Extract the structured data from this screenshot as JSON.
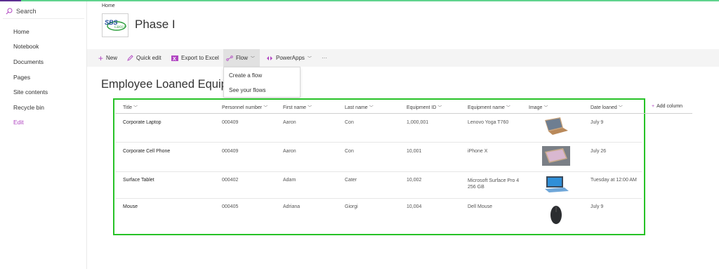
{
  "sidebar": {
    "search_label": "Search",
    "items": [
      {
        "label": "Home"
      },
      {
        "label": "Notebook"
      },
      {
        "label": "Documents"
      },
      {
        "label": "Pages"
      },
      {
        "label": "Site contents"
      },
      {
        "label": "Recycle bin"
      },
      {
        "label": "Edit"
      }
    ]
  },
  "header": {
    "breadcrumb": "Home",
    "site_title": "Phase I",
    "logo_text": "SBS GROUP"
  },
  "command_bar": {
    "new_label": "New",
    "quick_edit_label": "Quick edit",
    "export_label": "Export to Excel",
    "flow_label": "Flow",
    "powerapps_label": "PowerApps",
    "more_label": "···"
  },
  "flow_menu": {
    "items": [
      {
        "label": "Create a flow"
      },
      {
        "label": "See your flows"
      }
    ]
  },
  "list": {
    "title": "Employee Loaned Equipment",
    "add_column_label": "Add column",
    "columns": [
      "Title",
      "Personnel number",
      "First name",
      "Last name",
      "Equipment ID",
      "Equipment name",
      "Image",
      "Date loaned"
    ],
    "rows": [
      {
        "title": "Corporate Laptop",
        "personnel": "000409",
        "first": "Aaron",
        "last": "Con",
        "equip_id": "1,000,001",
        "equip_name": "Lenovo Yoga T760",
        "image": "laptop-image",
        "date": "July 9"
      },
      {
        "title": "Corporate Cell Phone",
        "personnel": "000409",
        "first": "Aaron",
        "last": "Con",
        "equip_id": "10,001",
        "equip_name": "iPhone X",
        "image": "phone-image",
        "date": "July 26"
      },
      {
        "title": "Surface Tablet",
        "personnel": "000402",
        "first": "Adam",
        "last": "Cater",
        "equip_id": "10,002",
        "equip_name": "Microsoft Surface Pro 4 256 GB",
        "image": "tablet-image",
        "date": "Tuesday at 12:00 AM"
      },
      {
        "title": "Mouse",
        "personnel": "000405",
        "first": "Adriana",
        "last": "Giorgi",
        "equip_id": "10,004",
        "equip_name": "Dell Mouse",
        "image": "mouse-image",
        "date": "July 9"
      }
    ]
  },
  "colors": {
    "accent_purple": "#b146c2",
    "highlight_green": "#27c227",
    "command_bar_bg": "#f4f4f4"
  }
}
